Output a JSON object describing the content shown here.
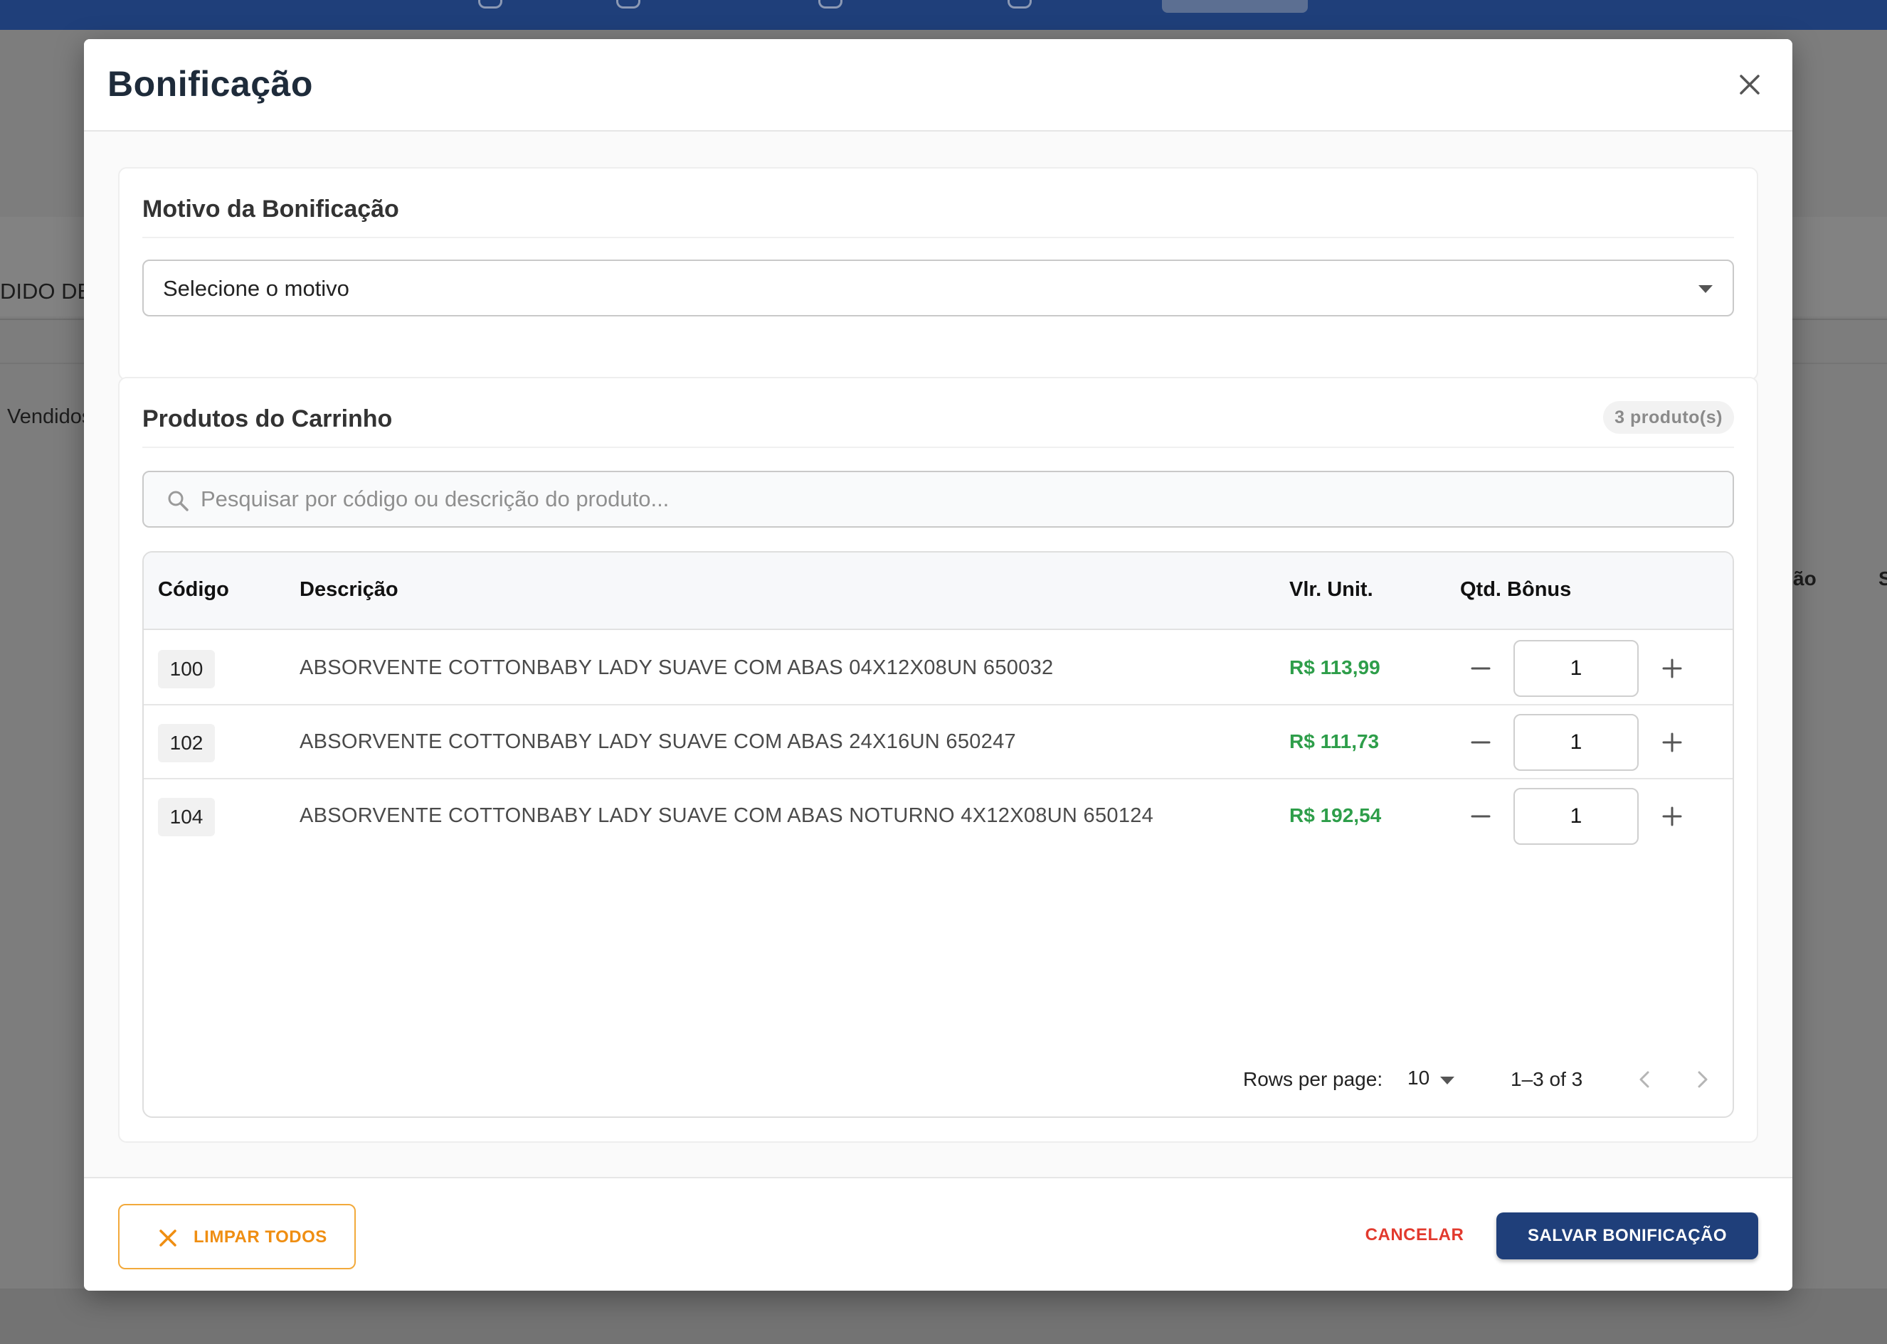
{
  "background": {
    "left_text": "DIDO DE",
    "left_text2": "Vendidos",
    "right_col1": "ão",
    "right_col2": "S"
  },
  "modal": {
    "title": "Bonificação",
    "reason_card": {
      "title": "Motivo da Bonificação",
      "select_placeholder": "Selecione o motivo"
    },
    "products_card": {
      "title": "Produtos do Carrinho",
      "count_badge": "3 produto(s)",
      "search_placeholder": "Pesquisar por código ou descrição do produto...",
      "columns": {
        "code": "Código",
        "description": "Descrição",
        "unit_price": "Vlr. Unit.",
        "bonus_qty": "Qtd. Bônus"
      },
      "rows": [
        {
          "code": "100",
          "description": "ABSORVENTE COTTONBABY LADY SUAVE COM ABAS 04X12X08UN 650032",
          "price": "R$ 113,99",
          "qty": "1"
        },
        {
          "code": "102",
          "description": "ABSORVENTE COTTONBABY LADY SUAVE COM ABAS 24X16UN 650247",
          "price": "R$ 111,73",
          "qty": "1"
        },
        {
          "code": "104",
          "description": "ABSORVENTE COTTONBABY LADY SUAVE COM ABAS NOTURNO 4X12X08UN 650124",
          "price": "R$ 192,54",
          "qty": "1"
        }
      ],
      "pagination": {
        "rows_per_page_label": "Rows per page:",
        "rows_per_page": "10",
        "range": "1–3 of 3"
      }
    },
    "footer": {
      "clear_label": "LIMPAR TODOS",
      "cancel_label": "CANCELAR",
      "save_label": "SALVAR BONIFICAÇÃO"
    }
  },
  "colors": {
    "brand": "#1f3f7a",
    "price_green": "#2e9e4a",
    "clear_orange": "#ef8e12",
    "cancel_red": "#e23a2e"
  },
  "icons": {
    "close": "close-icon",
    "search": "search-icon",
    "minus": "minus-icon",
    "plus": "plus-icon",
    "clear": "close-icon",
    "prev": "chevron-left-icon",
    "next": "chevron-right-icon",
    "dropdown": "caret-down-icon"
  }
}
